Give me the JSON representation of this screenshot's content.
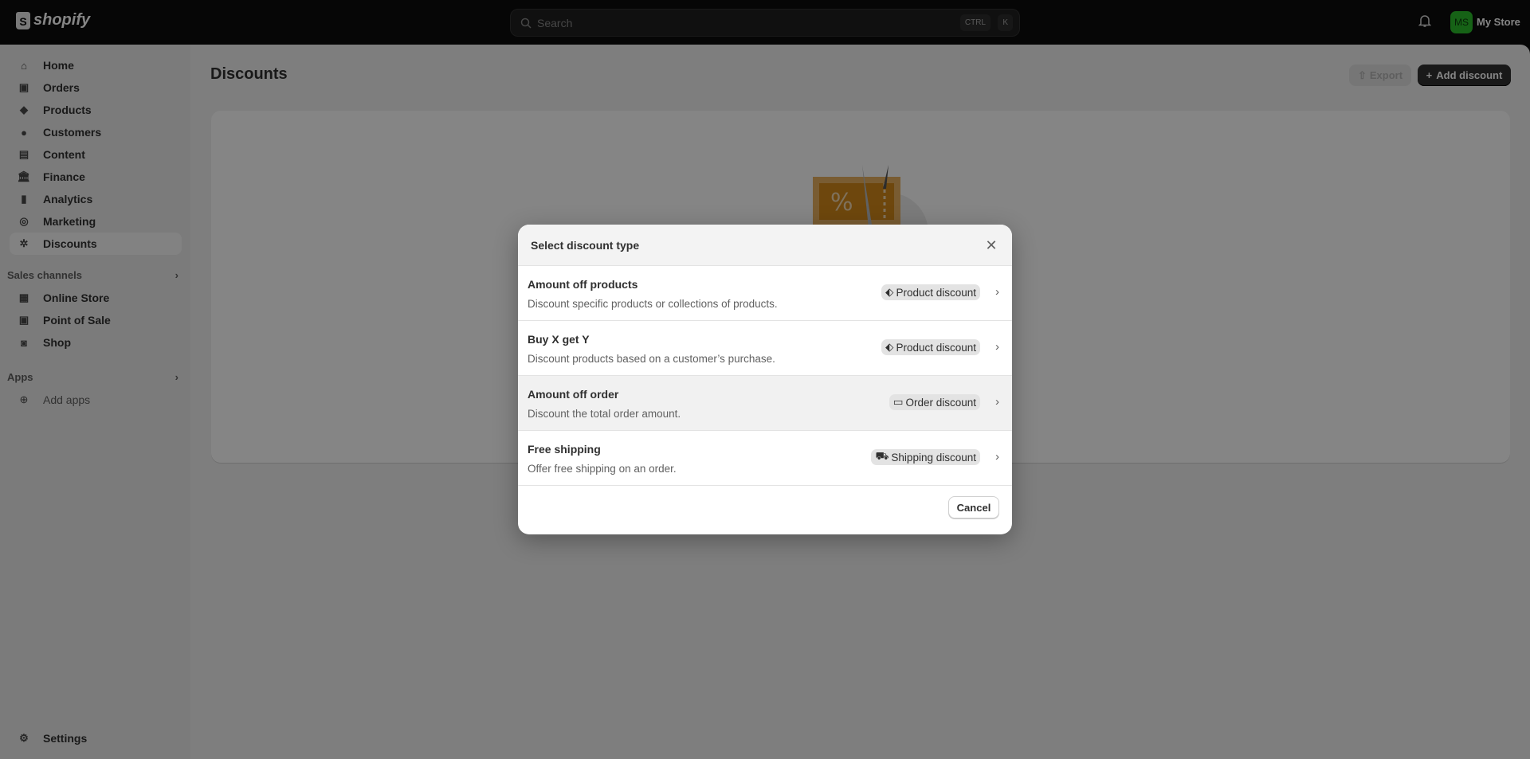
{
  "topbar": {
    "brand": "shopify",
    "search_placeholder": "Search",
    "shortcut_ctrl": "CTRL",
    "shortcut_k": "K",
    "avatar_initials": "MS",
    "avatar_color": "#2bbd2b",
    "store_name": "My Store"
  },
  "sidebar": {
    "items": [
      {
        "label": "Home",
        "icon": "home-icon"
      },
      {
        "label": "Orders",
        "icon": "inbox-icon"
      },
      {
        "label": "Products",
        "icon": "tag-icon"
      },
      {
        "label": "Customers",
        "icon": "person-icon"
      },
      {
        "label": "Content",
        "icon": "image-icon"
      },
      {
        "label": "Finance",
        "icon": "bank-icon"
      },
      {
        "label": "Analytics",
        "icon": "bar-chart-icon"
      },
      {
        "label": "Marketing",
        "icon": "target-icon"
      },
      {
        "label": "Discounts",
        "icon": "discount-icon",
        "active": true
      }
    ],
    "sales_channels_label": "Sales channels",
    "channels": [
      {
        "label": "Online Store"
      },
      {
        "label": "Point of Sale"
      },
      {
        "label": "Shop"
      }
    ],
    "apps_label": "Apps",
    "add_apps": "Add apps",
    "settings": "Settings"
  },
  "page": {
    "title": "Discounts",
    "export_label": "Export",
    "add_label": "Add discount"
  },
  "modal": {
    "title": "Select discount type",
    "options": [
      {
        "title": "Amount off products",
        "description": "Discount specific products or collections of products.",
        "badge": "Product discount",
        "badge_icon": "tag-icon"
      },
      {
        "title": "Buy X get Y",
        "description": "Discount products based on a customer’s purchase.",
        "badge": "Product discount",
        "badge_icon": "tag-icon"
      },
      {
        "title": "Amount off order",
        "description": "Discount the total order amount.",
        "badge": "Order discount",
        "badge_icon": "receipt-icon"
      },
      {
        "title": "Free shipping",
        "description": "Offer free shipping on an order.",
        "badge": "Shipping discount",
        "badge_icon": "truck-icon"
      }
    ],
    "cancel_label": "Cancel"
  }
}
